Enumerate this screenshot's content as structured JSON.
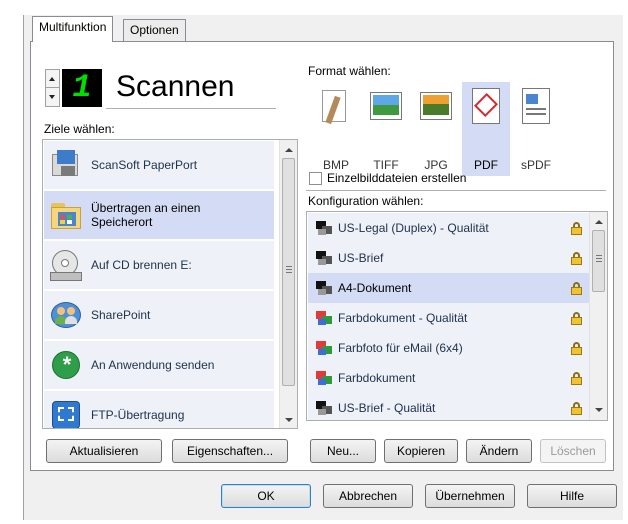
{
  "tabs": {
    "active": "Multifunktion",
    "other": "Optionen"
  },
  "mode": {
    "digit": "1",
    "title": "Scannen"
  },
  "destinations": {
    "label": "Ziele wählen:",
    "items": [
      {
        "label": "ScanSoft PaperPort",
        "icon": "paperport-icon"
      },
      {
        "label": "Übertragen an einen Speicherort",
        "icon": "folder-icon",
        "selected": true
      },
      {
        "label": "Auf CD brennen  E:",
        "icon": "cd-drive-icon"
      },
      {
        "label": "SharePoint",
        "icon": "sharepoint-icon"
      },
      {
        "label": "An Anwendung senden",
        "icon": "send-to-app-icon"
      },
      {
        "label": "FTP-Übertragung",
        "icon": "ftp-icon"
      }
    ],
    "refresh_label": "Aktualisieren",
    "properties_label": "Eigenschaften..."
  },
  "format": {
    "label": "Format wählen:",
    "items": [
      "BMP",
      "TIFF",
      "JPG",
      "PDF",
      "sPDF"
    ],
    "selected": "PDF",
    "single_files_label": "Einzelbilddateien erstellen",
    "single_files_checked": false
  },
  "config": {
    "label": "Konfiguration wählen:",
    "items": [
      {
        "label": "US-Legal (Duplex) - Qualität",
        "type": "bw"
      },
      {
        "label": "US-Brief",
        "type": "bw"
      },
      {
        "label": "A4-Dokument",
        "type": "bw",
        "selected": true
      },
      {
        "label": "Farbdokument - Qualität",
        "type": "color"
      },
      {
        "label": "Farbfoto für eMail (6x4)",
        "type": "color"
      },
      {
        "label": "Farbdokument",
        "type": "color"
      },
      {
        "label": "US-Brief - Qualität",
        "type": "bw"
      }
    ],
    "new_label": "Neu...",
    "copy_label": "Kopieren",
    "edit_label": "Ändern",
    "delete_label": "Löschen"
  },
  "footer": {
    "ok": "OK",
    "cancel": "Abbrechen",
    "apply": "Übernehmen",
    "help": "Hilfe"
  },
  "colors": {
    "selection": "#d4dcf5",
    "row": "#eef1f8",
    "digit": "#00ff00",
    "accent": "#3c7fb1"
  }
}
